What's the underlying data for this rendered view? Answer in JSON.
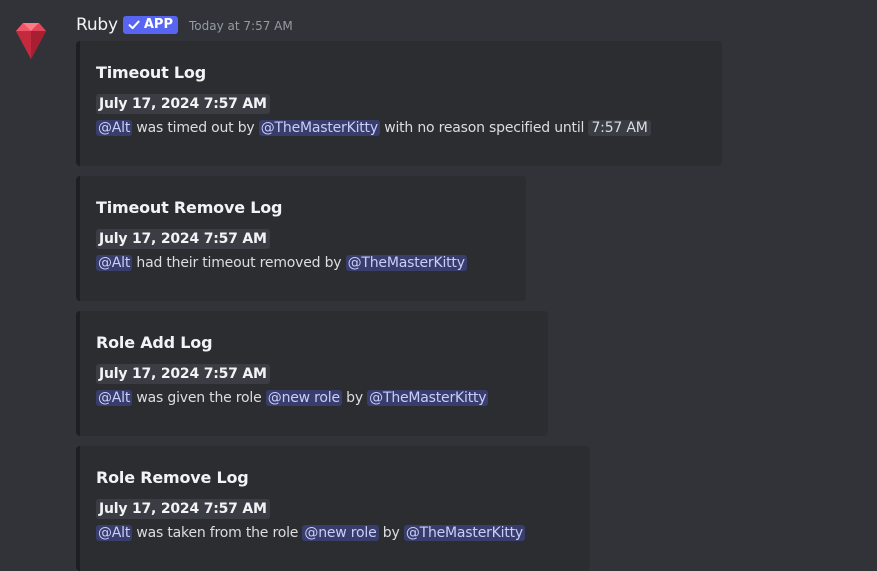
{
  "message": {
    "username": "Ruby",
    "app_tag": "APP",
    "timestamp": "Today at 7:57 AM",
    "avatar_icon": "ruby-gem-icon"
  },
  "colors": {
    "background": "#313338",
    "embed_background": "#2b2d31",
    "app_tag": "#5865f2",
    "mention_text": "#c9cdfb"
  },
  "embeds": [
    {
      "title": "Timeout Log",
      "date": "July 17, 2024 7:57 AM",
      "user": "@Alt",
      "text1": " was timed out by ",
      "actor": "@TheMasterKitty",
      "text2": " with no reason specified until ",
      "until": "7:57 AM"
    },
    {
      "title": "Timeout Remove Log",
      "date": "July 17, 2024 7:57 AM",
      "user": "@Alt",
      "text1": " had their timeout removed by ",
      "actor": "@TheMasterKitty"
    },
    {
      "title": "Role Add Log",
      "date": "July 17, 2024 7:57 AM",
      "user": "@Alt",
      "text1": " was given the role ",
      "role": "@new role",
      "text2": " by ",
      "actor": "@TheMasterKitty"
    },
    {
      "title": "Role Remove Log",
      "date": "July 17, 2024 7:57 AM",
      "user": "@Alt",
      "text1": " was taken from the role ",
      "role": "@new role",
      "text2": " by ",
      "actor": "@TheMasterKitty"
    }
  ]
}
